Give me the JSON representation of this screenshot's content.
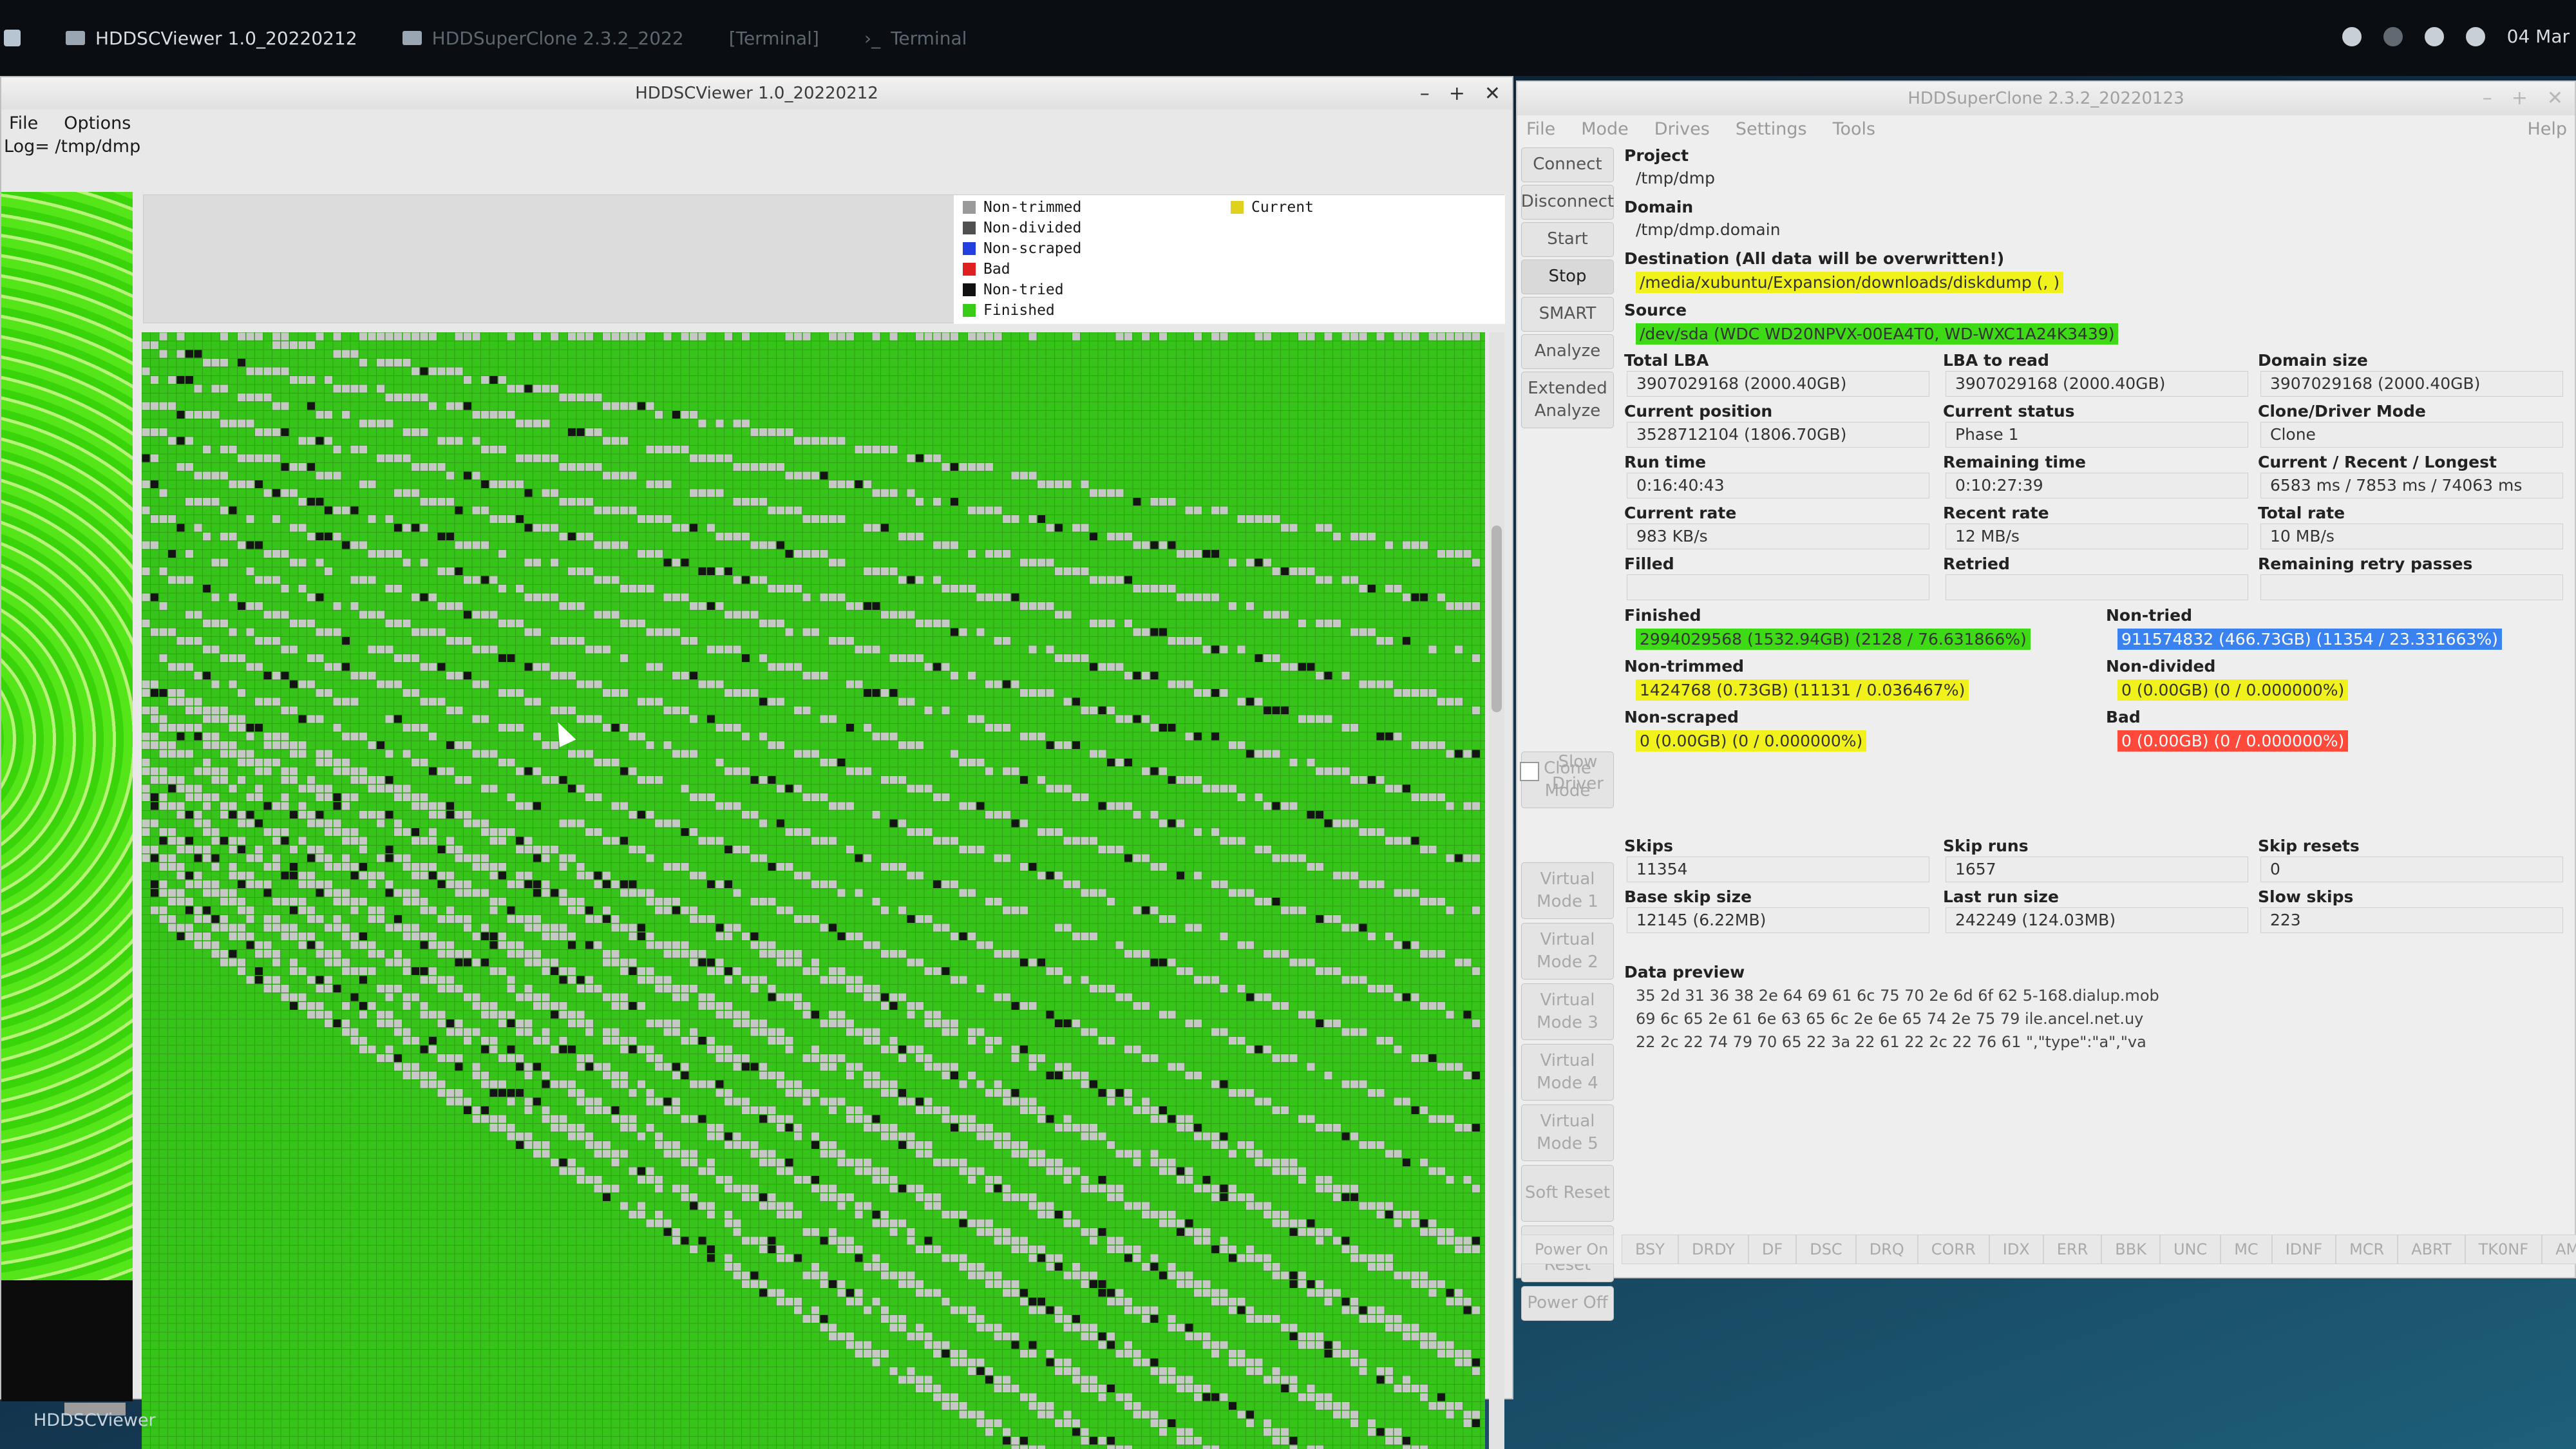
{
  "taskbar": {
    "items": [
      {
        "label": "HDDSCViewer 1.0_20220212",
        "active": true
      },
      {
        "label": "HDDSuperClone 2.3.2_2022",
        "active": false
      },
      {
        "label": "[Terminal]",
        "active": false
      },
      {
        "label": "Terminal",
        "active": false
      }
    ],
    "clock": "04 Mar"
  },
  "viewer": {
    "title": "HDDSCViewer 1.0_20220212",
    "menu": [
      "File",
      "Options"
    ],
    "log": "Log= /tmp/dmp",
    "legend": [
      {
        "label": "Non-trimmed",
        "color": "#9a9a9a"
      },
      {
        "label": "Non-divided",
        "color": "#505050"
      },
      {
        "label": "Non-scraped",
        "color": "#2240e0"
      },
      {
        "label": "Bad",
        "color": "#e02020"
      },
      {
        "label": "Non-tried",
        "color": "#111111"
      },
      {
        "label": "Finished",
        "color": "#38cc18"
      }
    ],
    "current_label": "Current",
    "current_color": "#e0d020",
    "bottom_label": "HDDSCViewer",
    "grid": {
      "finished_color": "#36c41a",
      "nontrimmed_color": "#c7c7c7",
      "nontried_color": "#141414",
      "grid_line_color": "#2ea014"
    }
  },
  "clone": {
    "title": "HDDSuperClone 2.3.2_20220123",
    "menu": [
      "File",
      "Mode",
      "Drives",
      "Settings",
      "Tools",
      "Help"
    ],
    "sidebar": {
      "connect": "Connect",
      "disconnect": "Disconnect",
      "start": "Start",
      "stop": "Stop",
      "smart": "SMART",
      "analyze": "Analyze",
      "extended_analyze": "Extended Analyze",
      "clone_mode": "Clone Mode",
      "slow_driver": "Slow Driver",
      "vm1": "Virtual Mode 1",
      "vm2": "Virtual Mode 2",
      "vm3": "Virtual Mode 3",
      "vm4": "Virtual Mode 4",
      "vm5": "Virtual Mode 5",
      "soft_reset": "Soft Reset",
      "hard_reset": "Hard Reset",
      "power_off": "Power Off",
      "power_on": "Power On"
    },
    "project": {
      "label": "Project",
      "value": "/tmp/dmp"
    },
    "domain": {
      "label": "Domain",
      "value": "/tmp/dmp.domain"
    },
    "destination": {
      "label": "Destination (All data will be overwritten!)",
      "value": "/media/xubuntu/Expansion/downloads/diskdump (, )"
    },
    "source": {
      "label": "Source",
      "value": "/dev/sda (WDC WD20NPVX-00EA4T0, WD-WXC1A24K3439)"
    },
    "stats": [
      [
        {
          "label": "Total LBA",
          "value": "3907029168 (2000.40GB)"
        },
        {
          "label": "LBA to read",
          "value": "3907029168 (2000.40GB)"
        },
        {
          "label": "Domain size",
          "value": "3907029168 (2000.40GB)"
        }
      ],
      [
        {
          "label": "Current position",
          "value": "3528712104 (1806.70GB)"
        },
        {
          "label": "Current status",
          "value": "Phase 1"
        },
        {
          "label": "Clone/Driver Mode",
          "value": "Clone"
        }
      ],
      [
        {
          "label": "Run time",
          "value": "0:16:40:43"
        },
        {
          "label": "Remaining time",
          "value": "0:10:27:39"
        },
        {
          "label": "Current / Recent / Longest",
          "value": "6583 ms / 7853 ms / 74063 ms"
        }
      ],
      [
        {
          "label": "Current rate",
          "value": "983 KB/s"
        },
        {
          "label": "Recent rate",
          "value": "12 MB/s"
        },
        {
          "label": "Total rate",
          "value": "10 MB/s"
        }
      ],
      [
        {
          "label": "Filled",
          "value": ""
        },
        {
          "label": "Retried",
          "value": ""
        },
        {
          "label": "Remaining retry passes",
          "value": ""
        }
      ]
    ],
    "progress": {
      "finished": {
        "label": "Finished",
        "value": "2994029568 (1532.94GB) (2128 / 76.631866%)"
      },
      "non_tried": {
        "label": "Non-tried",
        "value": "911574832 (466.73GB) (11354 / 23.331663%)"
      },
      "non_trimmed": {
        "label": "Non-trimmed",
        "value": "1424768 (0.73GB) (11131 / 0.036467%)"
      },
      "non_divided": {
        "label": "Non-divided",
        "value": "0 (0.00GB) (0 / 0.000000%)"
      },
      "non_scraped": {
        "label": "Non-scraped",
        "value": "0 (0.00GB) (0 / 0.000000%)"
      },
      "bad": {
        "label": "Bad",
        "value": "0 (0.00GB) (0 / 0.000000%)"
      }
    },
    "skips": [
      [
        {
          "label": "Skips",
          "value": "11354"
        },
        {
          "label": "Skip runs",
          "value": "1657"
        },
        {
          "label": "Skip resets",
          "value": "0"
        }
      ],
      [
        {
          "label": "Base skip size",
          "value": "12145 (6.22MB)"
        },
        {
          "label": "Last run size",
          "value": "242249 (124.03MB)"
        },
        {
          "label": "Slow skips",
          "value": "223"
        }
      ]
    ],
    "data_preview": {
      "label": "Data preview",
      "lines": [
        "35 2d 31 36 38 2e 64 69 61 6c 75 70 2e 6d 6f 62 5-168.dialup.mob",
        "69 6c 65 2e 61 6e 63 65 6c 2e 6e 65 74 2e 75 79 ile.ancel.net.uy",
        "22 2c 22 74 79 70 65 22 3a 22 61 22 2c 22 76 61 \",\"type\":\"a\",\"va"
      ]
    },
    "status_flags": [
      "BSY",
      "DRDY",
      "DF",
      "DSC",
      "DRQ",
      "CORR",
      "IDX",
      "ERR",
      "BBK",
      "UNC",
      "MC",
      "IDNF",
      "MCR",
      "ABRT",
      "TK0NF",
      "AMNF"
    ]
  }
}
